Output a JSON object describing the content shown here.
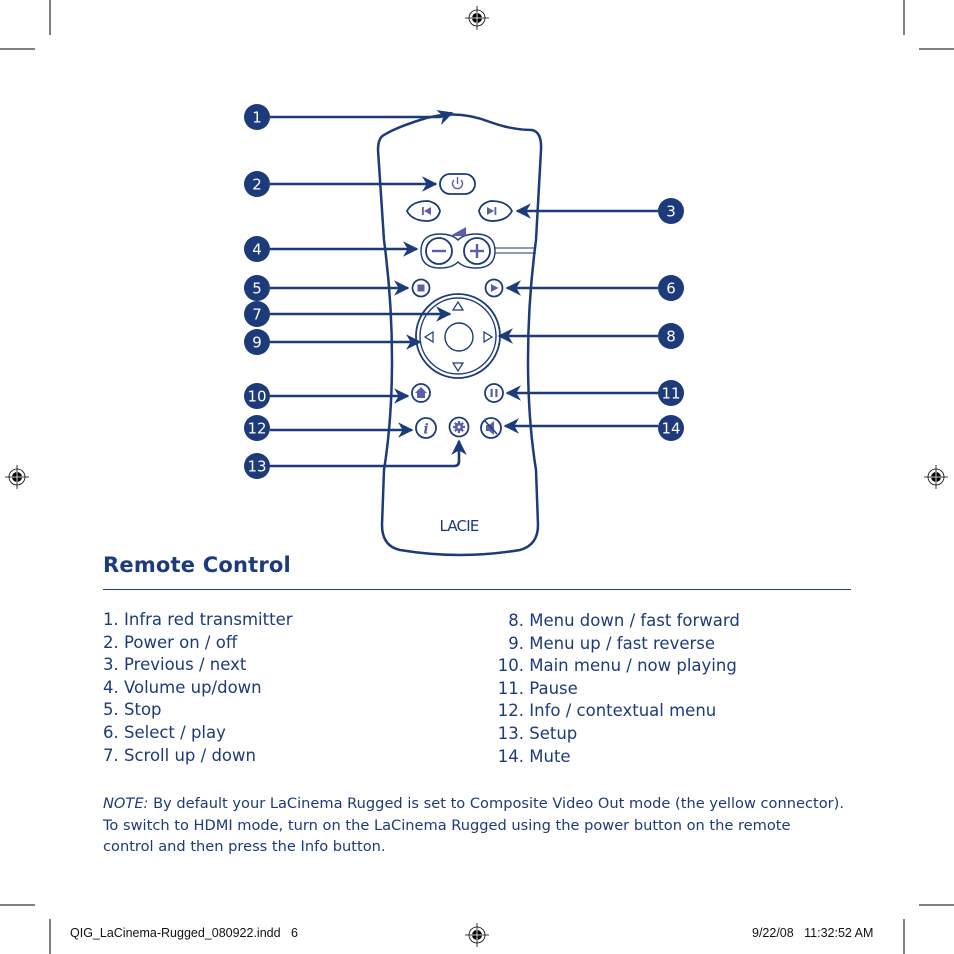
{
  "document": {
    "section_title": "Remote Control",
    "brand_logo": "LACIE",
    "callouts": [
      "1",
      "2",
      "3",
      "4",
      "5",
      "6",
      "7",
      "8",
      "9",
      "10",
      "11",
      "12",
      "13",
      "14"
    ],
    "remote_buttons": {
      "power": "power-icon",
      "previous": "skip-previous-icon",
      "next": "skip-next-icon",
      "volume_down": "minus-icon",
      "volume_up": "plus-icon",
      "stop": "stop-icon",
      "play": "play-icon",
      "nav_up": "triangle-up-icon",
      "nav_down": "triangle-down-icon",
      "nav_left": "triangle-left-icon",
      "nav_right": "triangle-right-icon",
      "home": "home-icon",
      "pause": "pause-icon",
      "info": "info-icon",
      "setup": "gear-icon",
      "mute": "mute-icon"
    },
    "items_left": [
      {
        "num": "1.",
        "label": "Infra red transmitter"
      },
      {
        "num": "2.",
        "label": "Power on / off"
      },
      {
        "num": "3.",
        "label": "Previous / next"
      },
      {
        "num": "4.",
        "label": "Volume up/down"
      },
      {
        "num": "5.",
        "label": "Stop"
      },
      {
        "num": "6.",
        "label": "Select / play"
      },
      {
        "num": "7.",
        "label": "Scroll up / down"
      }
    ],
    "items_right": [
      {
        "num": "8.",
        "label": "Menu down / fast forward"
      },
      {
        "num": "9.",
        "label": "Menu up / fast reverse"
      },
      {
        "num": "10.",
        "label": "Main menu / now playing"
      },
      {
        "num": "11.",
        "label": "Pause"
      },
      {
        "num": "12.",
        "label": "Info / contextual menu"
      },
      {
        "num": "13.",
        "label": "Setup"
      },
      {
        "num": "14.",
        "label": "Mute"
      }
    ],
    "note": {
      "label": "NOTE:",
      "line1": "By default your LaCinema Rugged is set to Composite Video Out mode (the yellow connector).",
      "line2": "To switch to HDMI mode, turn on the LaCinema Rugged using the power button on the remote",
      "line3": "control and then press the Info button."
    }
  },
  "print_slug": {
    "file_name": "QIG_LaCinema-Rugged_080922.indd   6",
    "timestamp": "9/22/08   11:32:52 AM"
  },
  "colors": {
    "primary": "#1d3a7a",
    "accent_icon": "#5a5fa8",
    "registration": "#000000"
  }
}
